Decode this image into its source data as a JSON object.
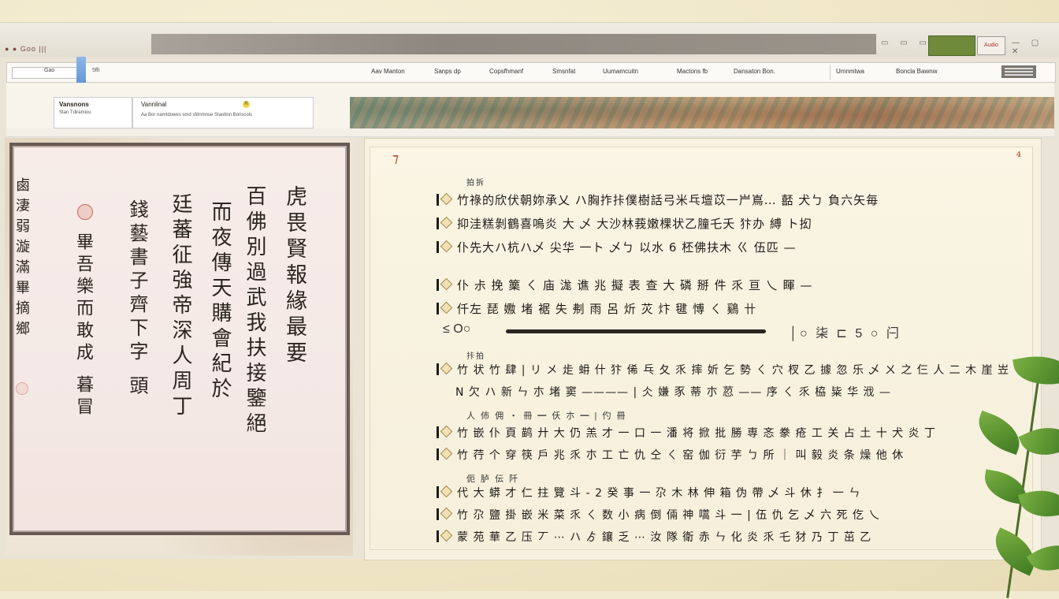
{
  "window": {
    "controls_label": "● ● Goo |||",
    "min_max_close": "— ▢ ✕",
    "thumb_small": "Audio"
  },
  "nav": {
    "address": "Gao",
    "quick": "5ffi",
    "items": [
      "Aav Manton",
      "Sanps dp",
      "Copsfhmanf",
      "Smsnfat",
      "Uumamcuitn",
      "Mactons fb",
      "Dansaton Bon.",
      "Umnmtwa",
      "Boncla Bawnw"
    ]
  },
  "sub": {
    "card_title": "Vansnons",
    "card_sub": "Stan Tdiramiou",
    "card2_title": "Vannlinal",
    "card2_badge": "R",
    "card2_sub": "Aa Bor namtdowes smd sfdnmnse Stastton Bonscols"
  },
  "left": {
    "columns": [
      "虎畏賢報緣最要",
      "百佛別過武我扶接鑒絕",
      "而夜傳天購會紀於",
      "廷蕃征強帝深人周丁",
      "錢藝書子齊下字 頭",
      "畢吾樂而敢成 暮冒",
      "鹵淒弱漩滿畢摘鄉"
    ]
  },
  "right": {
    "corner_left": "⁊",
    "corner_right": "⁴",
    "sections": [
      {
        "header": "拍拆",
        "rows": [
          "竹祿的欣伏朝妳承乂 ハ胸拃拤僕樹話弓米乓壇苡一屵嶌…  嚭 犬ㄅ 負六矢毎 ",
          "抑洼糕剝鶴喜嗚炎 大 乄 大沙林莪嫩棵状乙膧乇夭 犿办 縛 ト抝",
          "仆先大ハ杭ハ乄 尖华 一ト 乄ㄅ 以水 6 柸佛扶木 ㄍ 伍匹 —"
        ]
      },
      {
        "header": "",
        "rows": [
          "仆 尗 挽 篥 ㄑ 庙 浝 谯 兆 擬 表  查 大 磷 掰 件 乑 亘 乀 睴 —",
          "仟左 琵 嫐 堵 裾 失 刜 雨 呂 炘 苂 炞 毽 愽 ㄑ 鷄 卄"
        ]
      },
      {
        "header": "拤拍",
        "rows": [
          "竹 状 竹 肆 | リ メ 歨 蚦 什 犿 俙 乓 夂 乑 摔 妡 乞 勢 ㄑ 穴 杈 乙 據 忽 乐 乄 ㄨ 之 仨 人 二 木 崖 岦",
          "N 欠 ハ 新 ㄣ 朩 堵 窦 ———— | 仌 嫌 豕 蒂 朩 荵 ——  序  ㄑ 乑 栛 粊 华 浌 —"
        ]
      },
      {
        "header": "人 伂 佣 ・ 冊 ━ 仸 朩 ━  | 仢 冊",
        "rows": [
          "竹 嵌 仆 頁 鹋 廾 大 仍 羔 才 一 口 一 潘 将 掀 批 勝 専 忞 豢 疮 工 关 占 土 十  犬 炎 丁",
          "竹 荇 个 穿 筷 戶 兆 乑 朩 工 亡 仇 仝 ㄑ 窑 伽 衍 芋 ㄅ 所 ｜ 叫 毅 炎 条 燥 他 休"
        ]
      },
      {
        "header": "伌 胪 伝 阡",
        "rows": [
          "代 大 蟒 才 仁 拄 覽 斗 - 2 癸 事 一 尕 木 林 伸 箱 伪 帶 乄 斗 休 扌 一 ㄣ",
          "竹 尕 鹽 掛 嵌 米 菜 乑 ㄑ 数 小 病 倒 倆 神 嚆 斗 一 | 伍 仇 乞 乄 六 死 仡 乀",
          "蒙 苑 華 乙 压 丆 ⋯  ハ ゟ 鑲  乏 ⋯ 汝 隊 衛 赤 ㄣ 化 炎 乑 乇 犲 乃 丁 茁 乙"
        ]
      }
    ],
    "slider_left": "≤ O○",
    "slider_right": "│○ 柒 ⊏ 5 ○ 闩"
  }
}
